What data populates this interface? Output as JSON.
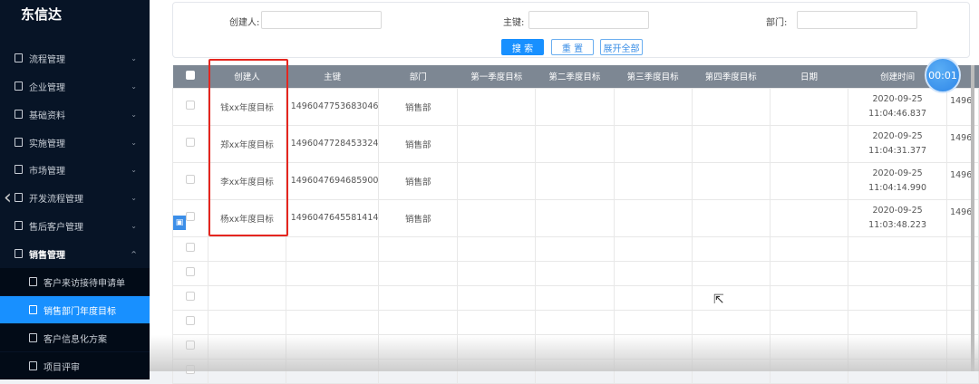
{
  "app": {
    "title": "东信达"
  },
  "sidebar": {
    "items": [
      {
        "label": "流程管理"
      },
      {
        "label": "企业管理"
      },
      {
        "label": "基础资料"
      },
      {
        "label": "实施管理"
      },
      {
        "label": "市场管理"
      },
      {
        "label": "开发流程管理"
      },
      {
        "label": "售后客户管理"
      },
      {
        "label": "销售管理"
      }
    ],
    "sub_items": [
      {
        "label": "客户来访接待申请单"
      },
      {
        "label": "销售部门年度目标"
      },
      {
        "label": "客户信息化方案"
      },
      {
        "label": "项目评审"
      }
    ]
  },
  "search": {
    "creator_label": "创建人:",
    "key_label": "主键:",
    "dept_label": "部门:",
    "search_btn": "搜 索",
    "reset_btn": "重 置",
    "expand_btn": "展开全部"
  },
  "table": {
    "columns": [
      "创建人",
      "主键",
      "部门",
      "第一季度目标",
      "第二季度目标",
      "第三季度目标",
      "第四季度目标",
      "日期",
      "创建时间"
    ],
    "rows": [
      {
        "creator": "钱xx年度目标",
        "key": "1496047753683046",
        "dept": "销售部",
        "date1": "2020-09-25",
        "date2": "11:04:46.837",
        "extra": "1496"
      },
      {
        "creator": "郑xx年度目标",
        "key": "1496047728453324",
        "dept": "销售部",
        "date1": "2020-09-25",
        "date2": "11:04:31.377",
        "extra": "1496"
      },
      {
        "creator": "李xx年度目标",
        "key": "1496047694685900",
        "dept": "销售部",
        "date1": "2020-09-25",
        "date2": "11:04:14.990",
        "extra": "1496"
      },
      {
        "creator": "杨xx年度目标",
        "key": "1496047645581414",
        "dept": "销售部",
        "date1": "2020-09-25",
        "date2": "11:03:48.223",
        "extra": "1496"
      }
    ]
  },
  "timer": "00:01"
}
